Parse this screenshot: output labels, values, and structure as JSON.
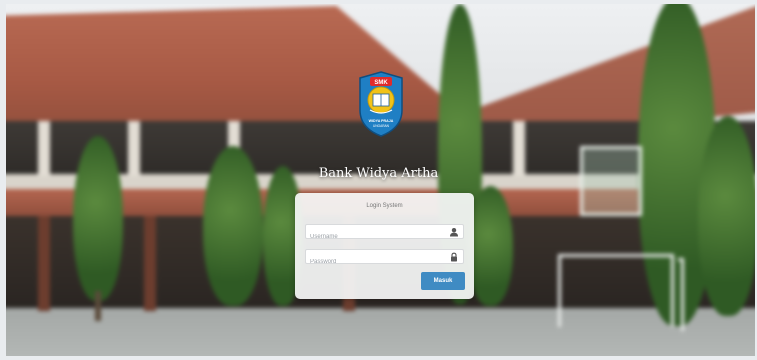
{
  "brand": {
    "title": "Bank Widya Artha",
    "logo_label": "SMK",
    "logo_caption_line1": "WIDYA PRAJA",
    "logo_caption_line2": "UNGARAN"
  },
  "login": {
    "heading": "Login System",
    "username_placeholder": "Username",
    "password_placeholder": "Password",
    "submit_label": "Masuk"
  },
  "icons": {
    "username": "user-icon",
    "password": "lock-icon"
  },
  "colors": {
    "primary_button": "#3f8bc3",
    "logo_blue": "#1f7fc4",
    "logo_gold": "#f2c318"
  }
}
